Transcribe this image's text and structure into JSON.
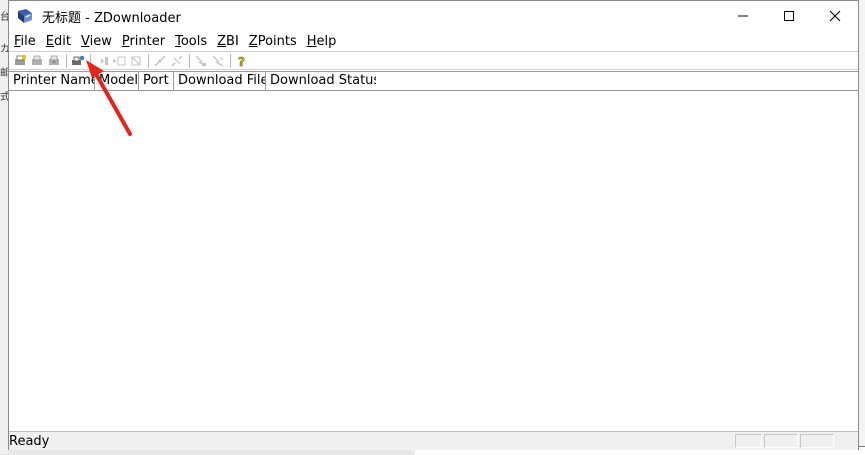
{
  "window": {
    "title": "无标题 - ZDownloader"
  },
  "menu": [
    {
      "label": "File",
      "accel": "F",
      "rest": "ile"
    },
    {
      "label": "Edit",
      "accel": "E",
      "rest": "dit"
    },
    {
      "label": "View",
      "accel": "V",
      "rest": "iew"
    },
    {
      "label": "Printer",
      "accel": "P",
      "rest": "rinter"
    },
    {
      "label": "Tools",
      "accel": "T",
      "rest": "ools"
    },
    {
      "label": "ZBI",
      "accel": "Z",
      "rest": "BI"
    },
    {
      "label": "ZPoints",
      "accel": "Z",
      "rest": "Points"
    },
    {
      "label": "Help",
      "accel": "H",
      "rest": "elp"
    }
  ],
  "toolbar": {
    "icons": [
      "new-printer-icon",
      "printer-settings-icon",
      "printer-refresh-icon",
      "add-printer-icon",
      "download-icon",
      "download-all-icon",
      "cancel-download-icon",
      "connect-icon",
      "disconnect-icon",
      "zbi-run-icon",
      "zbi-stop-icon",
      "help-icon"
    ]
  },
  "table": {
    "columns": [
      "Printer Name",
      "Model",
      "Port",
      "Download File",
      "Download Status"
    ]
  },
  "status": {
    "text": "Ready"
  },
  "colors": {
    "annotation_arrow": "#e8231a",
    "help_icon": "#e6c200"
  }
}
